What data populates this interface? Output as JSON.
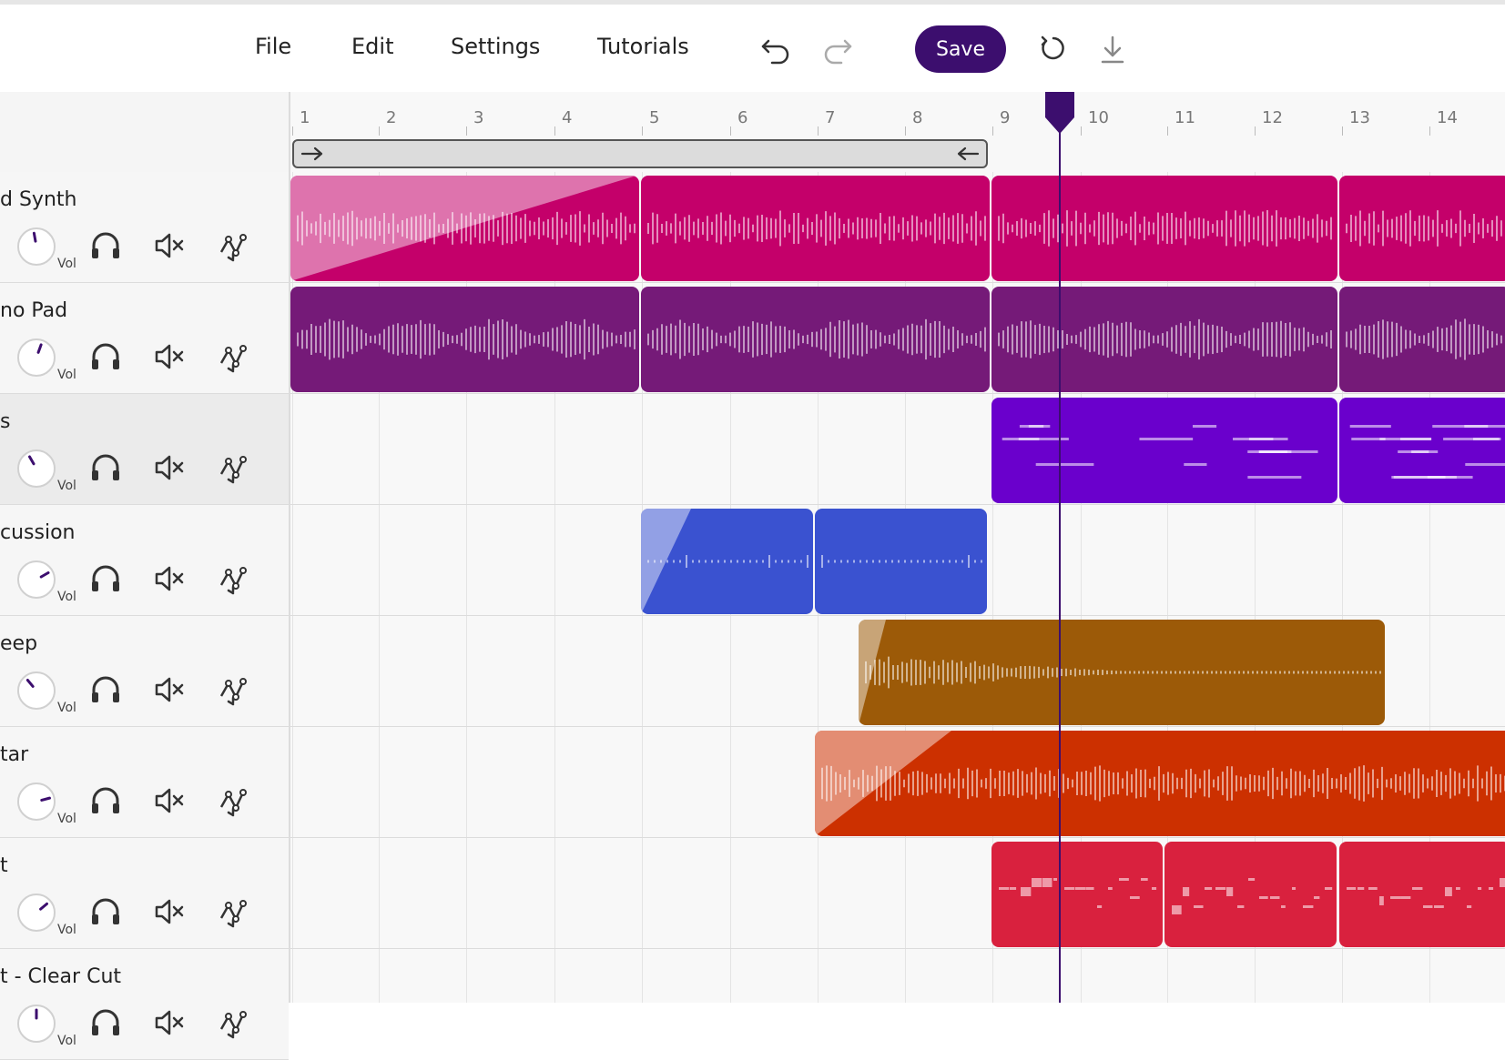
{
  "menu": {
    "file": "File",
    "edit": "Edit",
    "settings": "Settings",
    "tutorials": "Tutorials"
  },
  "toolbar": {
    "save_label": "Save",
    "icons": [
      "undo-icon",
      "redo-icon",
      "refresh-icon",
      "download-icon"
    ]
  },
  "accent_color": "#3c0e6e",
  "ruler": {
    "bars": [
      "1",
      "2",
      "3",
      "4",
      "5",
      "6",
      "7",
      "8",
      "9",
      "10",
      "11",
      "12",
      "13",
      "14"
    ]
  },
  "tracks": [
    {
      "name": "d Synth",
      "vol_label": "Vol",
      "color": "#c4006a"
    },
    {
      "name": "no Pad",
      "vol_label": "Vol",
      "color": "#751a78"
    },
    {
      "name": "s",
      "vol_label": "Vol",
      "color": "#6a00cc"
    },
    {
      "name": "cussion",
      "vol_label": "Vol",
      "color": "#3a52d0"
    },
    {
      "name": "eep",
      "vol_label": "Vol",
      "color": "#9c5a08"
    },
    {
      "name": "tar",
      "vol_label": "Vol",
      "color": "#cc3000"
    },
    {
      "name": "t",
      "vol_label": "Vol",
      "color": "#d9213e"
    },
    {
      "name": "t - Clear Cut",
      "vol_label": "Vol",
      "color": "#888888"
    }
  ]
}
